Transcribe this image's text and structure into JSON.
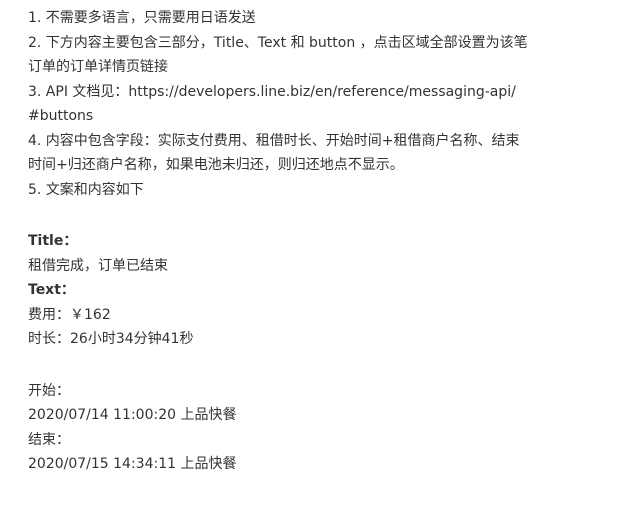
{
  "requirements": {
    "item1": "1. 不需要多语言，只需要用日语发送",
    "item2_line1": "2. 下方内容主要包含三部分，Title、Text 和 button ，点击区域全部设置为该笔",
    "item2_line2": "订单的订单详情页链接",
    "item3_line1": "3. API 文档见：https://developers.line.biz/en/reference/messaging-api/",
    "item3_line2": "#buttons",
    "item4_line1": "4. 内容中包含字段：实际支付费用、租借时长、开始时间+租借商户名称、结束",
    "item4_line2": "时间+归还商户名称，如果电池未归还，则归还地点不显示。",
    "item5": "5. 文案和内容如下"
  },
  "content": {
    "title_heading": "Title：",
    "title_value": "租借完成，订单已结束",
    "text_heading": "Text：",
    "fee_line": "费用：￥162",
    "duration_line": "时长：26小时34分钟41秒",
    "start_label": "开始：",
    "start_value": "2020/07/14 11:00:20 上品快餐",
    "end_label": "结束：",
    "end_value": "2020/07/15 14:34:11 上品快餐"
  }
}
